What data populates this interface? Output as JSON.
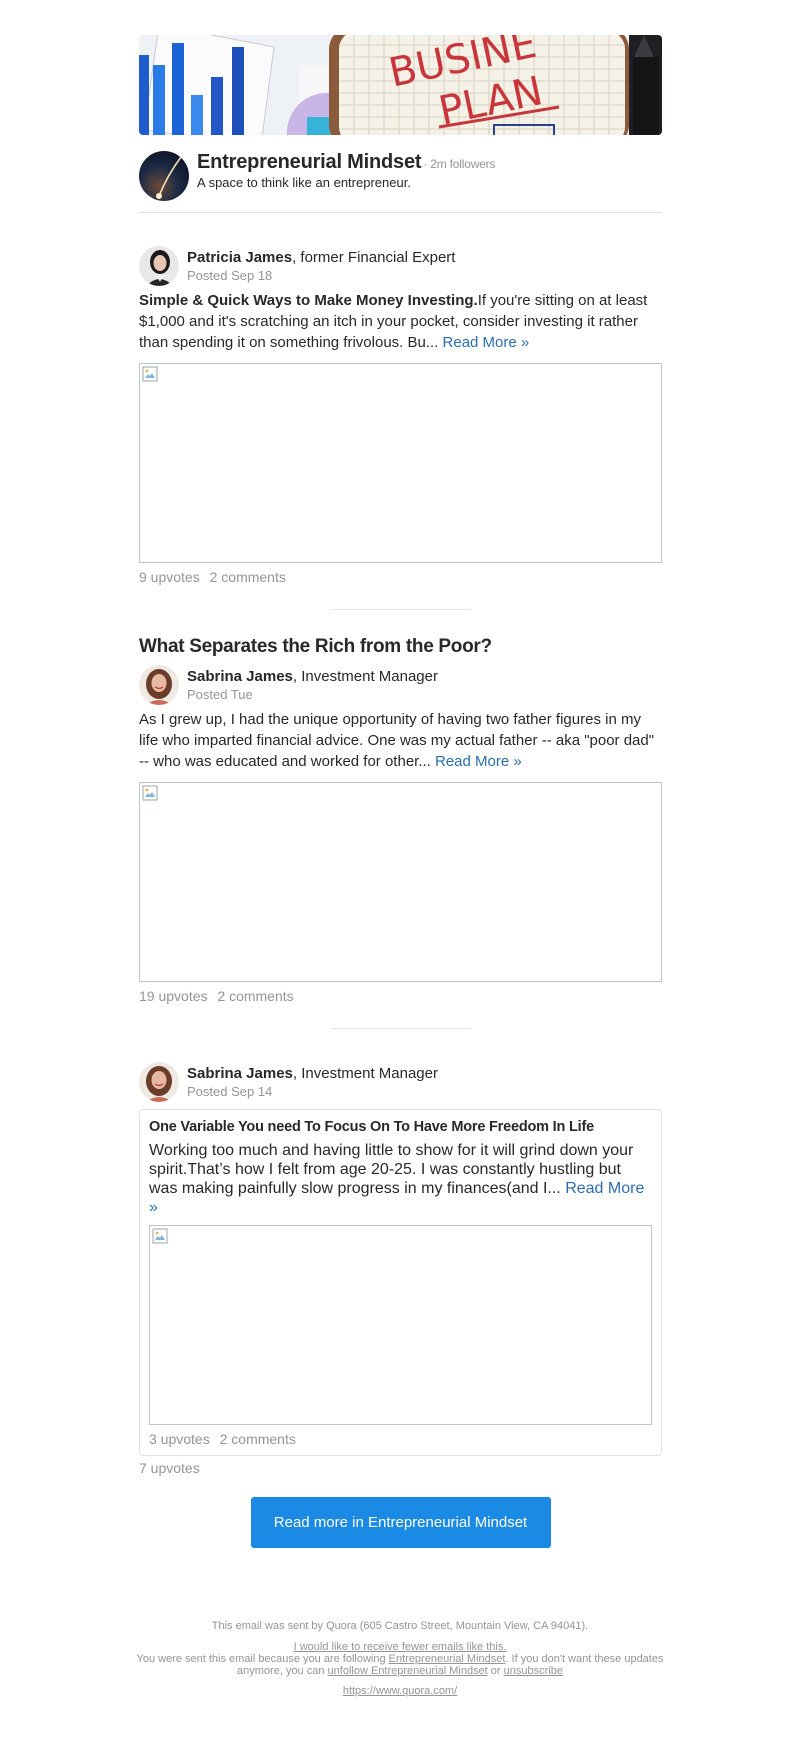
{
  "space": {
    "name": "Entrepreneurial Mindset",
    "followers": "· 2m followers",
    "tagline": "A space to think like an entrepreneur.",
    "banner_words": [
      "BUSINE",
      "PLAN"
    ]
  },
  "posts": [
    {
      "author_name": "Patricia James",
      "author_credential": ", former Financial Expert",
      "date": "Posted Sep 18",
      "bold_lead": "Simple & Quick Ways to Make Money Investing.",
      "excerpt": "If you're sitting on at least $1,000 and it's scratching an itch in your pocket, consider investing it rather than spending it on something frivolous. Bu...",
      "read_more": "Read More »",
      "upvotes": "9 upvotes",
      "comments": "2 comments"
    },
    {
      "title": "What Separates the Rich from the Poor?",
      "author_name": "Sabrina James",
      "author_credential": ", Investment Manager",
      "date": "Posted Tue",
      "excerpt": "As I grew up, I had the unique opportunity of having two father figures in my life who imparted financial advice. One was my actual father -- aka \"poor dad\" -- who was educated and worked for other...",
      "read_more": "Read More »",
      "upvotes": "19 upvotes",
      "comments": "2 comments"
    },
    {
      "author_name": "Sabrina James",
      "author_credential": ", Investment Manager",
      "date": "Posted Sep 14",
      "shared": {
        "title": "One Variable You need To Focus On To Have More Freedom In Life",
        "excerpt": "Working too much and having little to show for it will grind down your spirit.That’s how I felt from age 20-25. I was constantly hustling but was making painfully slow progress in my finances(and I...",
        "read_more": "Read More »",
        "upvotes": "3 upvotes",
        "comments": "2 comments"
      },
      "upvotes": "7 upvotes"
    }
  ],
  "cta": {
    "label": "Read more in Entrepreneurial Mindset"
  },
  "footer": {
    "sent_by": "This email was sent by Quora (605 Castro Street, Mountain View, CA 94041).",
    "fewer_emails": "I would like to receive fewer emails like this.",
    "reason_prefix": "You were sent this email because you are following ",
    "reason_space": "Entrepreneurial Mindset",
    "reason_mid": ". If you don't want these updates anymore, you can ",
    "unfollow": "unfollow Entrepreneurial Mindset",
    "or": " or ",
    "unsubscribe": "unsubscribe",
    "url": "https://www.quora.com/"
  },
  "colors": {
    "link": "#2b6dad",
    "cta_background": "#1a8ae4",
    "muted_text": "#939598",
    "body_text": "#282829"
  }
}
